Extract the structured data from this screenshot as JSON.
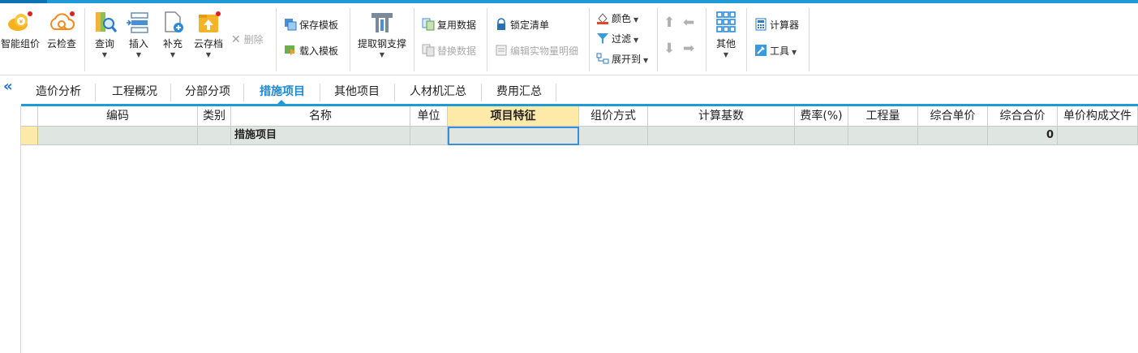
{
  "ribbon": {
    "smart_price_label": "智能组价",
    "cloud_check_label": "云检查",
    "query_label": "查询",
    "insert_label": "插入",
    "supplement_label": "补充",
    "cloud_archive_label": "云存档",
    "delete_label": "删除",
    "save_template_label": "保存模板",
    "load_template_label": "载入模板",
    "extract_rebar_label": "提取钢支撑",
    "reuse_data_label": "复用数据",
    "replace_data_label": "替换数据",
    "lock_list_label": "锁定清单",
    "edit_quantity_label": "编辑实物量明细",
    "color_label": "颜色",
    "filter_label": "过滤",
    "expand_label": "展开到",
    "other_label": "其他",
    "calculator_label": "计算器",
    "tools_label": "工具",
    "accent_color": "#1e9bd7"
  },
  "tabs": [
    {
      "label": "造价分析"
    },
    {
      "label": "工程概况"
    },
    {
      "label": "分部分项"
    },
    {
      "label": "措施项目"
    },
    {
      "label": "其他项目"
    },
    {
      "label": "人材机汇总"
    },
    {
      "label": "费用汇总"
    }
  ],
  "active_tab": "措施项目",
  "table": {
    "columns": [
      "编码",
      "类别",
      "名称",
      "单位",
      "项目特征",
      "组价方式",
      "计算基数",
      "费率(%)",
      "工程量",
      "综合单价",
      "综合合价",
      "单价构成文件"
    ],
    "rows": [
      {
        "code": "",
        "category": "",
        "name": "措施项目",
        "unit": "",
        "feature": "",
        "method": "",
        "base": "",
        "rate": "",
        "quantity": "",
        "unit_price": "",
        "total": "0",
        "file": ""
      }
    ]
  }
}
